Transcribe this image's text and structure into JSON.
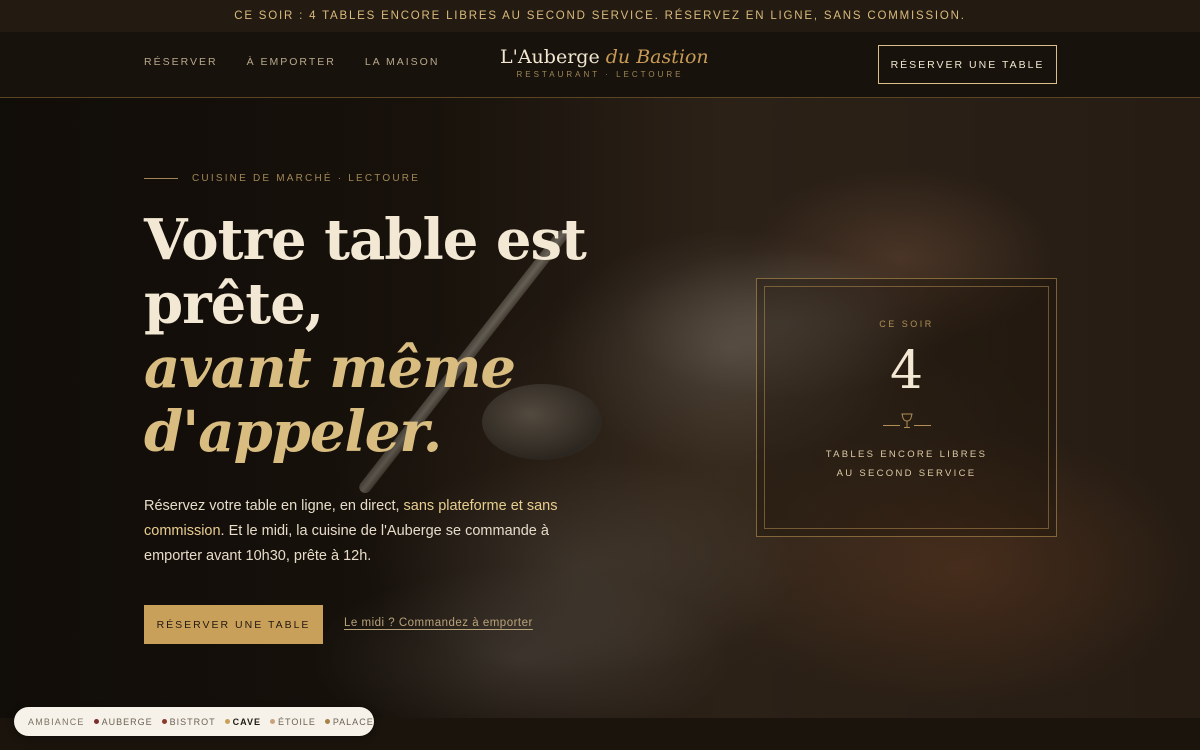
{
  "announcement": "CE SOIR : 4 TABLES ENCORE LIBRES AU SECOND SERVICE. RÉSERVEZ EN LIGNE, SANS COMMISSION.",
  "nav": {
    "links": [
      "RÉSERVER",
      "À EMPORTER",
      "LA MAISON"
    ],
    "brand_main": "L'Auberge",
    "brand_accent": "du Bastion",
    "brand_sub": "RESTAURANT · LECTOURE",
    "cta": "RÉSERVER UNE TABLE"
  },
  "hero": {
    "eyebrow": "CUISINE DE MARCHÉ · LECTOURE",
    "headline_line1": "Votre table est prête,",
    "headline_accent": "avant même d'appeler.",
    "lede_part1": "Réservez votre table en ligne, en direct, ",
    "lede_highlight": "sans plateforme et sans commission",
    "lede_part2": ". Et le midi, la cuisine de l'Auberge se commande à emporter avant 10h30, prête à 12h.",
    "primary_cta": "RÉSERVER UNE TABLE",
    "secondary_link": "Le midi ? Commandez à emporter"
  },
  "card": {
    "kicker": "CE SOIR",
    "number": "4",
    "caption_line1": "TABLES ENCORE LIBRES",
    "caption_line2": "AU SECOND SERVICE",
    "divider_icon": "wine-glass-icon"
  },
  "theme_switcher": {
    "label": "AMBIANCE",
    "options": [
      {
        "name": "AUBERGE",
        "color": "#7a2e2e",
        "active": false
      },
      {
        "name": "BISTROT",
        "color": "#8a3a2a",
        "active": false
      },
      {
        "name": "CAVE",
        "color": "#c9a05a",
        "active": true
      },
      {
        "name": "ÉTOILE",
        "color": "#c8a27a",
        "active": false
      },
      {
        "name": "PALACE",
        "color": "#a4824a",
        "active": false
      }
    ]
  },
  "colors": {
    "gold": "#c9a05a",
    "background": "#14100b",
    "cream": "#f3e8d3"
  }
}
